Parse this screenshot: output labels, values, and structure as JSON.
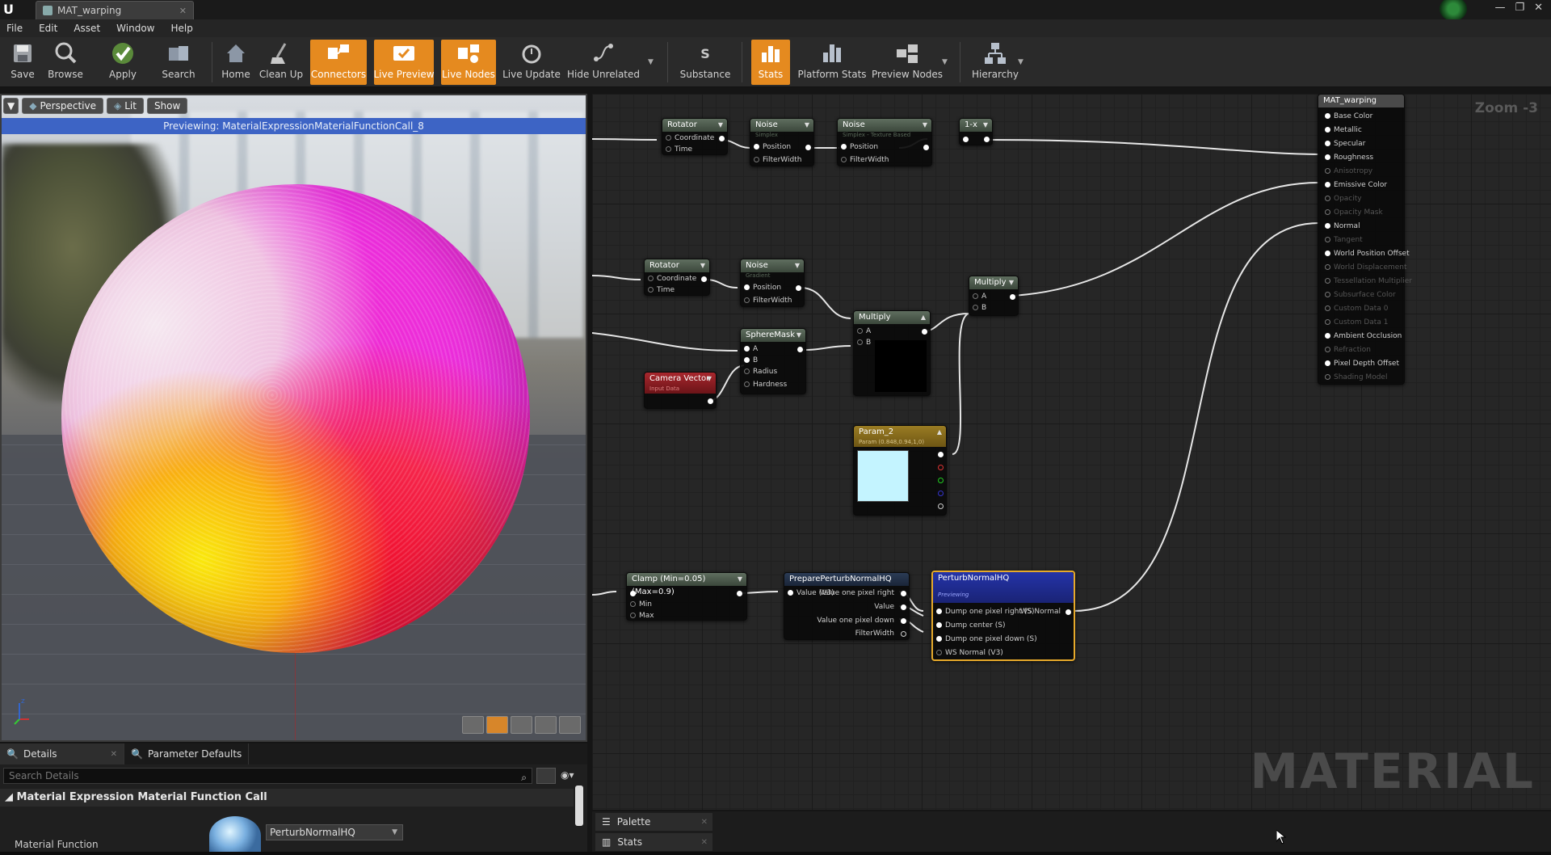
{
  "window": {
    "tab_label": "MAT_warping",
    "tab_close": "✕",
    "controls": [
      "—",
      "❐",
      "✕"
    ]
  },
  "menu": [
    "File",
    "Edit",
    "Asset",
    "Window",
    "Help"
  ],
  "toolbar": {
    "buttons": [
      {
        "label": "Save",
        "icon": "save-icon",
        "active": false
      },
      {
        "label": "Browse",
        "icon": "browse-icon",
        "active": false
      },
      {
        "label": "Apply",
        "icon": "apply-icon",
        "active": false
      },
      {
        "label": "Search",
        "icon": "search-icon",
        "active": false
      },
      {
        "label": "Home",
        "icon": "home-icon",
        "active": false
      },
      {
        "label": "Clean Up",
        "icon": "cleanup-icon",
        "active": false
      },
      {
        "label": "Connectors",
        "icon": "connectors-icon",
        "active": true
      },
      {
        "label": "Live Preview",
        "icon": "live-preview-icon",
        "active": true
      },
      {
        "label": "Live Nodes",
        "icon": "live-nodes-icon",
        "active": true
      },
      {
        "label": "Live Update",
        "icon": "live-update-icon",
        "active": false
      },
      {
        "label": "Hide Unrelated",
        "icon": "hide-unrelated-icon",
        "active": false
      },
      {
        "label": "Substance",
        "icon": "substance-icon",
        "active": false
      },
      {
        "label": "Stats",
        "icon": "stats-icon",
        "active": true
      },
      {
        "label": "Platform Stats",
        "icon": "platform-stats-icon",
        "active": false
      },
      {
        "label": "Preview Nodes",
        "icon": "preview-nodes-icon",
        "active": false
      },
      {
        "label": "Hierarchy",
        "icon": "hierarchy-icon",
        "active": false
      }
    ],
    "accent": "#e58a1f"
  },
  "viewport": {
    "perspective_label": "Perspective",
    "lit_label": "Lit",
    "show_label": "Show",
    "preview_text": "Previewing: MaterialExpressionMaterialFunctionCall_8"
  },
  "details": {
    "tab_details": "Details",
    "tab_params": "Parameter Defaults",
    "search_placeholder": "Search Details",
    "category": "Material Expression Material Function Call",
    "prop_label": "Material Function",
    "prop_value": "PerturbNormalHQ"
  },
  "graph": {
    "zoom": "Zoom -3",
    "watermark": "MATERIAL",
    "nodes": {
      "rotator1": {
        "title": "Rotator",
        "pins": [
          "Coordinate",
          "Time"
        ]
      },
      "noise1": {
        "title": "Noise",
        "sub": "Simplex",
        "pins": [
          "Position",
          "FilterWidth"
        ]
      },
      "noise2": {
        "title": "Noise",
        "sub": "Simplex - Texture Based",
        "pins": [
          "Position",
          "FilterWidth"
        ]
      },
      "oneminus": {
        "title": "1-x"
      },
      "rotator2": {
        "title": "Rotator",
        "pins": [
          "Coordinate",
          "Time"
        ]
      },
      "noise3": {
        "title": "Noise",
        "sub": "Gradient",
        "pins": [
          "Position",
          "FilterWidth"
        ]
      },
      "multiply1": {
        "title": "Multiply",
        "pins": [
          "A",
          "B"
        ]
      },
      "multiply2": {
        "title": "Multiply",
        "pins": [
          "A",
          "B"
        ]
      },
      "spheremask": {
        "title": "SphereMask",
        "pins": [
          "A",
          "B",
          "Radius",
          "Hardness"
        ]
      },
      "cameravector": {
        "title": "Camera Vector",
        "sub": "Input Data"
      },
      "param2": {
        "title": "Param_2",
        "sub": "Param (0.848,0.94,1,0)"
      },
      "clamp": {
        "title": "Clamp (Min=0.05) (Max=0.9)",
        "pins": [
          "Min",
          "Max"
        ]
      },
      "prepare": {
        "title": "PreparePerturbNormalHQ",
        "pins_in": [
          "Value (V3)"
        ],
        "pins_out": [
          "Value one pixel right",
          "Value",
          "Value one pixel down",
          "FilterWidth"
        ]
      },
      "perturb": {
        "title": "PerturbNormalHQ",
        "sub": "Previewing",
        "pins_in": [
          "Dump one pixel right (S)",
          "Dump center (S)",
          "Dump one pixel down (S)",
          "WS Normal (V3)"
        ],
        "pin_out": "WS Normal"
      },
      "result": {
        "title": "MAT_warping",
        "pins": [
          {
            "label": "Base Color",
            "enabled": true
          },
          {
            "label": "Metallic",
            "enabled": true
          },
          {
            "label": "Specular",
            "enabled": true
          },
          {
            "label": "Roughness",
            "enabled": true
          },
          {
            "label": "Anisotropy",
            "enabled": false
          },
          {
            "label": "Emissive Color",
            "enabled": true
          },
          {
            "label": "Opacity",
            "enabled": false
          },
          {
            "label": "Opacity Mask",
            "enabled": false
          },
          {
            "label": "Normal",
            "enabled": true
          },
          {
            "label": "Tangent",
            "enabled": false
          },
          {
            "label": "World Position Offset",
            "enabled": true
          },
          {
            "label": "World Displacement",
            "enabled": false
          },
          {
            "label": "Tessellation Multiplier",
            "enabled": false
          },
          {
            "label": "Subsurface Color",
            "enabled": false
          },
          {
            "label": "Custom Data 0",
            "enabled": false
          },
          {
            "label": "Custom Data 1",
            "enabled": false
          },
          {
            "label": "Ambient Occlusion",
            "enabled": true
          },
          {
            "label": "Refraction",
            "enabled": false
          },
          {
            "label": "Pixel Depth Offset",
            "enabled": true
          },
          {
            "label": "Shading Model",
            "enabled": false
          }
        ]
      }
    }
  },
  "bottom_tabs": {
    "palette": "Palette",
    "stats": "Stats"
  }
}
